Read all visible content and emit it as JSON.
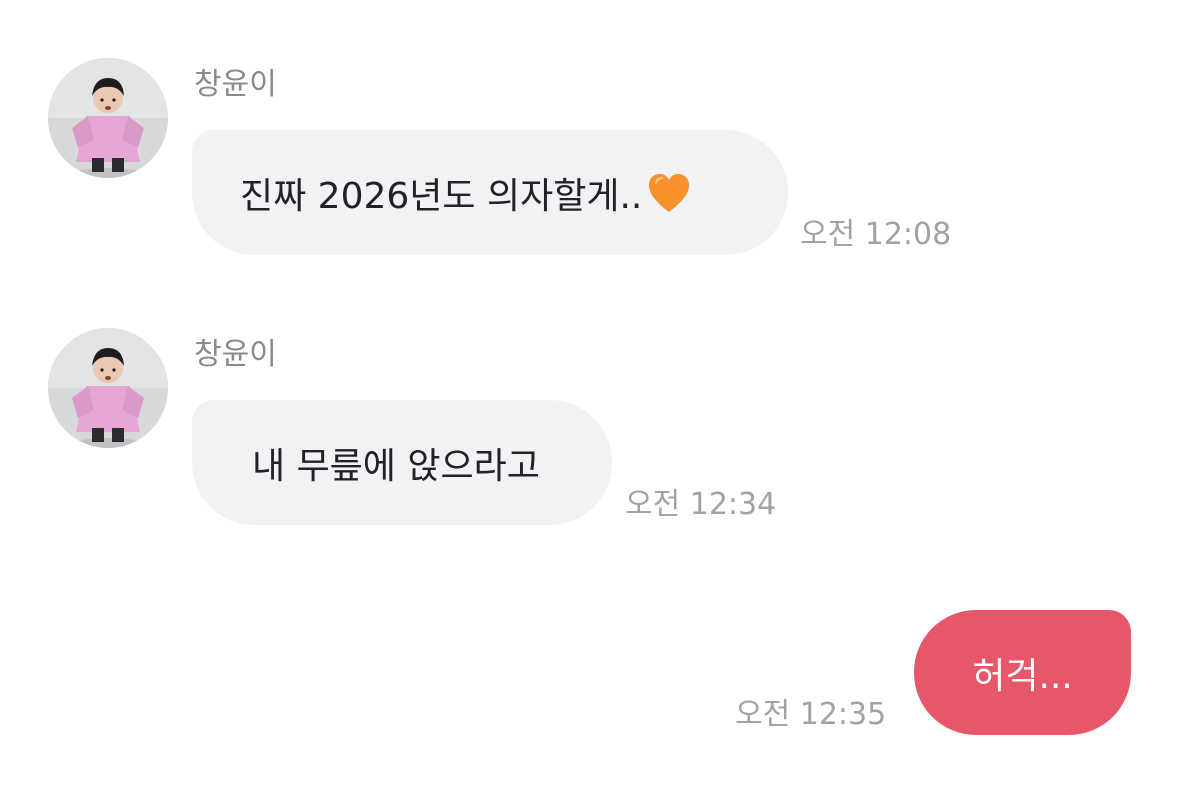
{
  "messages": [
    {
      "sender": "창윤이",
      "text": "진짜 2026년도 의자할게..",
      "emoji": "orange-heart",
      "time": "오전 12:08"
    },
    {
      "sender": "창윤이",
      "text": "내 무릎에 앉으라고",
      "time": "오전 12:34"
    }
  ],
  "reply": {
    "text": "허걱...",
    "time": "오전 12:35"
  },
  "colors": {
    "incoming_bubble": "#f2f2f5",
    "outgoing_bubble": "#e8566a",
    "heart": "#f7922b"
  }
}
